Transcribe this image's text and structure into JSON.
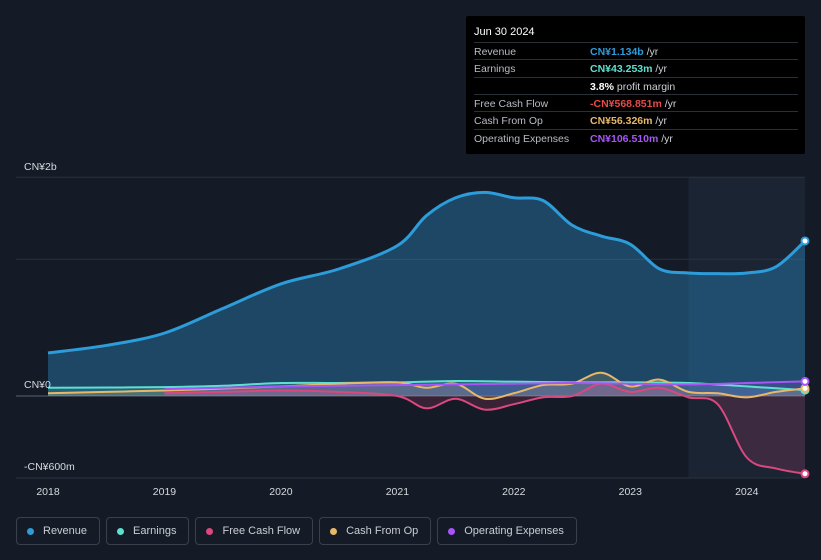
{
  "tooltip": {
    "date": "Jun 30 2024",
    "rows": [
      {
        "label": "Revenue",
        "value": "CN¥1.134b",
        "suffix": " /yr",
        "color": "#2d9cdb"
      },
      {
        "label": "Earnings",
        "value": "CN¥43.253m",
        "suffix": " /yr",
        "color": "#5ee0d0"
      },
      {
        "label": "",
        "value": "3.8%",
        "suffix": " profit margin",
        "color": "#ffffff"
      },
      {
        "label": "Free Cash Flow",
        "value": "-CN¥568.851m",
        "suffix": " /yr",
        "color": "#e84a4a"
      },
      {
        "label": "Cash From Op",
        "value": "CN¥56.326m",
        "suffix": " /yr",
        "color": "#e8b86a"
      },
      {
        "label": "Operating Expenses",
        "value": "CN¥106.510m",
        "suffix": " /yr",
        "color": "#a855f7"
      }
    ]
  },
  "legend": [
    {
      "label": "Revenue",
      "color": "#2d9cdb"
    },
    {
      "label": "Earnings",
      "color": "#5ee0d0"
    },
    {
      "label": "Free Cash Flow",
      "color": "#d9487f"
    },
    {
      "label": "Cash From Op",
      "color": "#e8b86a"
    },
    {
      "label": "Operating Expenses",
      "color": "#a855f7"
    }
  ],
  "chart_data": {
    "type": "area",
    "title": "",
    "xlabel": "",
    "ylabel": "",
    "y_tick_labels": [
      "CN¥2b",
      "CN¥0",
      "-CN¥600m"
    ],
    "x_tick_labels": [
      "2018",
      "2019",
      "2020",
      "2021",
      "2022",
      "2023",
      "2024"
    ],
    "xlim": [
      2018.0,
      2024.5
    ],
    "ylim": [
      -600,
      1600
    ],
    "highlight_from": 2023.5,
    "series": [
      {
        "name": "Revenue",
        "color": "#2d9cdb",
        "x": [
          2018.0,
          2018.5,
          2019.0,
          2019.5,
          2020.0,
          2020.5,
          2021.0,
          2021.25,
          2021.5,
          2021.75,
          2022.0,
          2022.25,
          2022.5,
          2022.75,
          2023.0,
          2023.25,
          2023.5,
          2023.75,
          2024.0,
          2024.25,
          2024.5
        ],
        "values": [
          315,
          370,
          460,
          640,
          820,
          930,
          1100,
          1320,
          1450,
          1490,
          1450,
          1430,
          1250,
          1170,
          1110,
          930,
          900,
          895,
          900,
          945,
          1134
        ]
      },
      {
        "name": "Earnings",
        "color": "#5ee0d0",
        "x": [
          2018.0,
          2018.5,
          2019.0,
          2019.5,
          2020.0,
          2020.5,
          2021.0,
          2021.5,
          2022.0,
          2022.5,
          2023.0,
          2023.5,
          2024.0,
          2024.5
        ],
        "values": [
          60,
          62,
          65,
          75,
          95,
          95,
          100,
          110,
          105,
          100,
          100,
          95,
          70,
          43
        ]
      },
      {
        "name": "Free Cash Flow",
        "color": "#d9487f",
        "x": [
          2019.0,
          2019.5,
          2020.0,
          2020.5,
          2021.0,
          2021.25,
          2021.5,
          2021.75,
          2022.0,
          2022.25,
          2022.5,
          2022.75,
          2023.0,
          2023.25,
          2023.5,
          2023.75,
          2024.0,
          2024.25,
          2024.5
        ],
        "values": [
          20,
          30,
          40,
          30,
          0,
          -90,
          -20,
          -100,
          -60,
          -10,
          0,
          90,
          30,
          60,
          -10,
          -60,
          -450,
          -530,
          -569
        ]
      },
      {
        "name": "Cash From Op",
        "color": "#e8b86a",
        "x": [
          2018.0,
          2018.5,
          2019.0,
          2019.5,
          2020.0,
          2020.5,
          2021.0,
          2021.25,
          2021.5,
          2021.75,
          2022.0,
          2022.25,
          2022.5,
          2022.75,
          2023.0,
          2023.25,
          2023.5,
          2023.75,
          2024.0,
          2024.25,
          2024.5
        ],
        "values": [
          20,
          30,
          40,
          55,
          70,
          90,
          100,
          60,
          90,
          -20,
          20,
          80,
          90,
          170,
          70,
          120,
          30,
          20,
          -10,
          30,
          56
        ]
      },
      {
        "name": "Operating Expenses",
        "color": "#a855f7",
        "x": [
          2019.0,
          2019.5,
          2020.0,
          2020.5,
          2021.0,
          2021.5,
          2022.0,
          2022.5,
          2023.0,
          2023.5,
          2024.0,
          2024.5
        ],
        "values": [
          50,
          60,
          70,
          75,
          80,
          85,
          90,
          95,
          90,
          85,
          95,
          107
        ]
      }
    ]
  }
}
